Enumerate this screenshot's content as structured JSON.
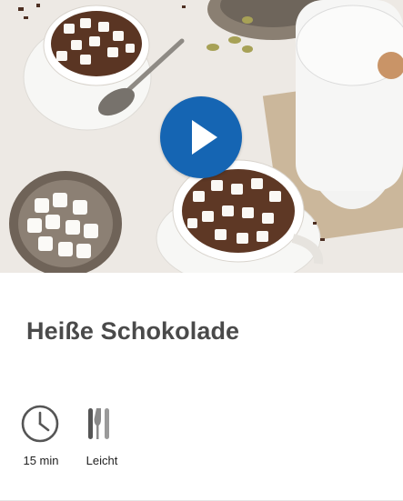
{
  "recipe": {
    "title": "Heiße Schokolade",
    "time_label": "15 min",
    "difficulty_label": "Leicht"
  },
  "icons": {
    "play": "play-icon",
    "time": "clock-icon",
    "difficulty": "cutlery-icon"
  },
  "colors": {
    "play_button": "#1565b3",
    "title_text": "#4a4a4a",
    "icon_gray": "#555555"
  }
}
